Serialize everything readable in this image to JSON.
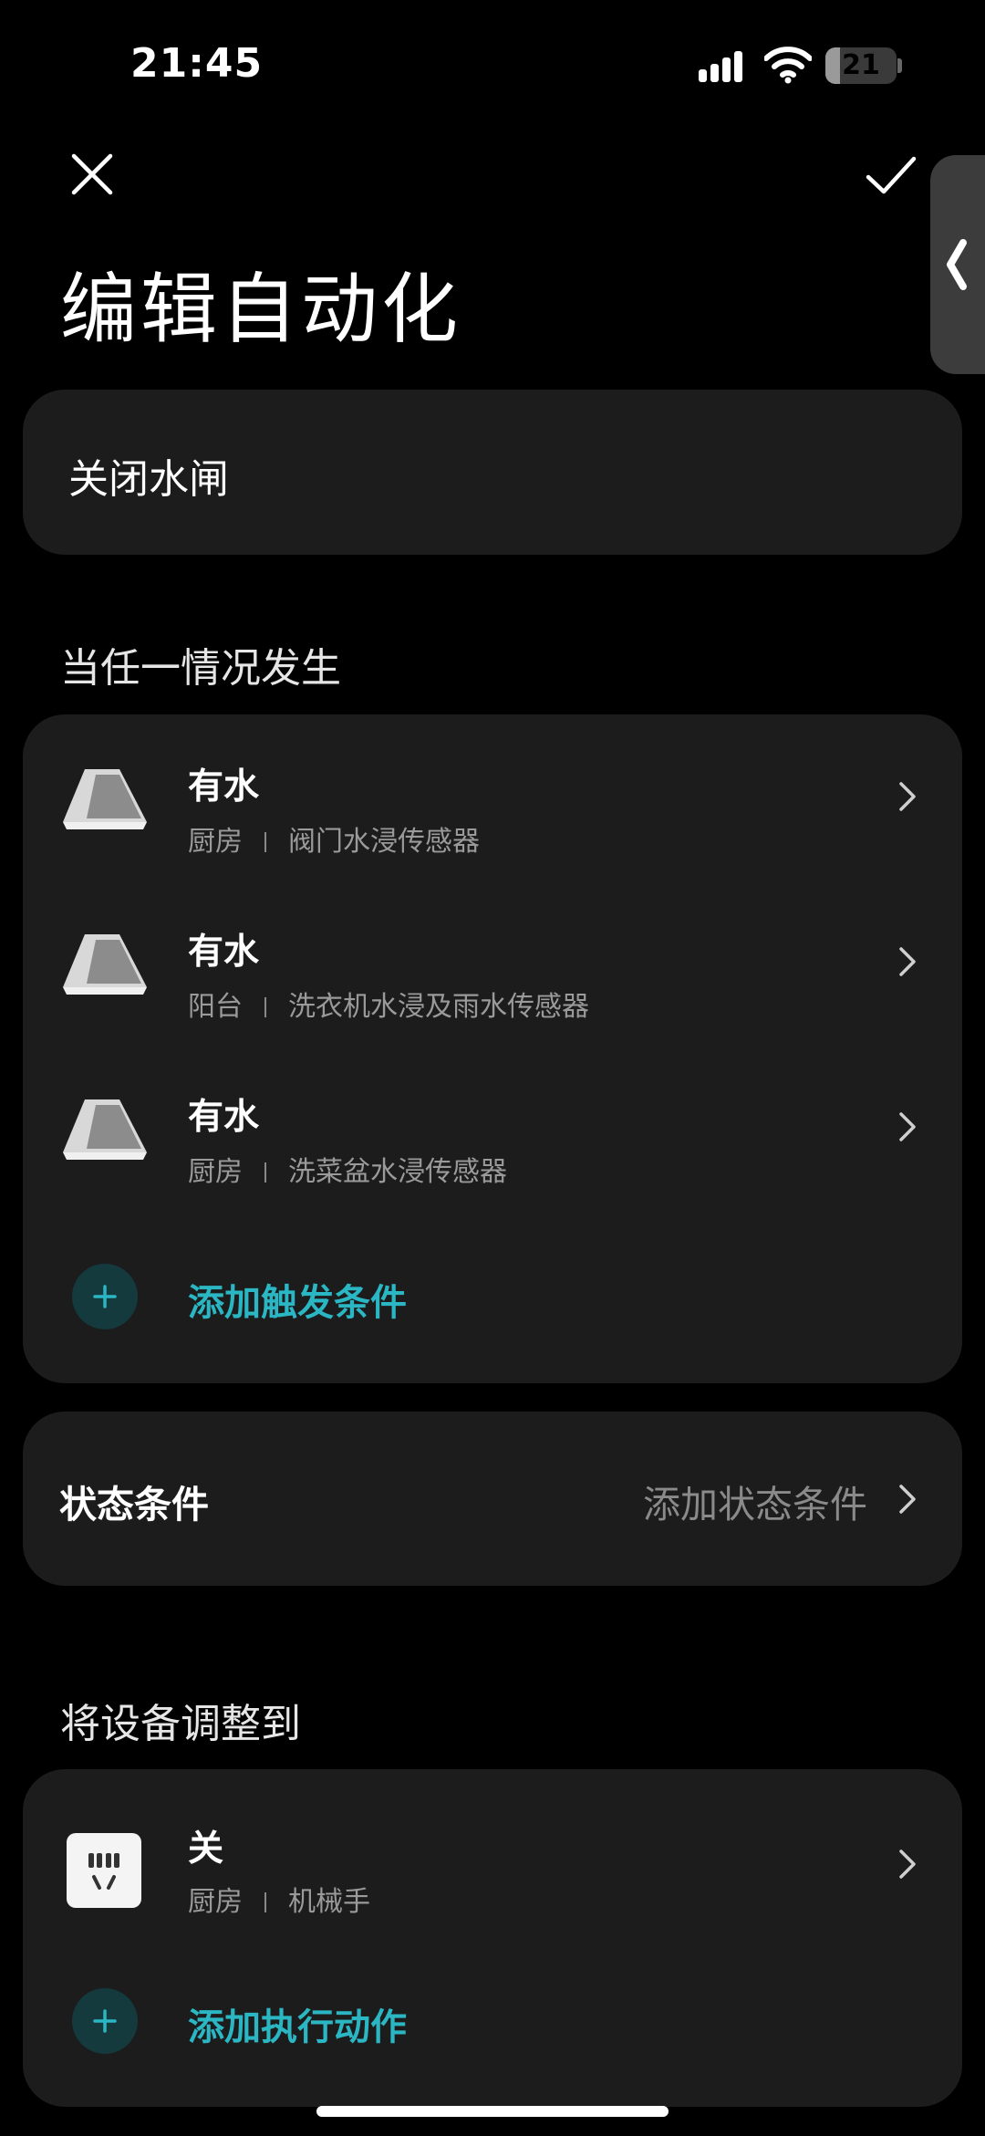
{
  "status_bar": {
    "time": "21:45",
    "battery": "21",
    "battery_level_percent": 21
  },
  "header": {
    "title": "编辑自动化",
    "close_icon": "close-icon",
    "confirm_icon": "checkmark-icon"
  },
  "automation_name": "关闭水闸",
  "trigger_section": {
    "label": "当任一情况发生",
    "items": [
      {
        "title": "有水",
        "room": "厨房",
        "device": "阀门水浸传感器",
        "icon": "water-leak-sensor-icon"
      },
      {
        "title": "有水",
        "room": "阳台",
        "device": "洗衣机水浸及雨水传感器",
        "icon": "water-leak-sensor-icon"
      },
      {
        "title": "有水",
        "room": "厨房",
        "device": "洗菜盆水浸传感器",
        "icon": "water-leak-sensor-icon"
      }
    ],
    "add_label": "添加触发条件"
  },
  "state_condition": {
    "label": "状态条件",
    "value": "添加状态条件"
  },
  "action_section": {
    "label": "将设备调整到",
    "items": [
      {
        "title": "关",
        "room": "厨房",
        "device": "机械手",
        "icon": "smart-plug-icon"
      }
    ],
    "add_label": "添加执行动作"
  },
  "colors": {
    "background": "#000000",
    "card": "#1c1c1c",
    "accent": "#2bb6c4",
    "secondary_text": "#9a9a9a"
  }
}
